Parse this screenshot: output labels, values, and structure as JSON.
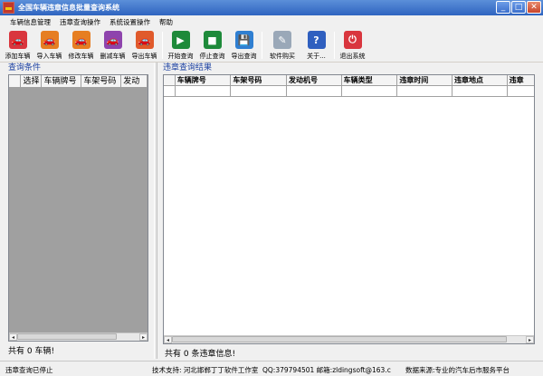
{
  "window": {
    "title": "全国车辆违章信息批量查询系统",
    "controls": {
      "minimize": "_",
      "maximize": "□",
      "close": "✕"
    }
  },
  "menu": {
    "items": [
      "车辆信息管理",
      "违章查询操作",
      "系统设置操作",
      "帮助"
    ]
  },
  "toolbar": {
    "buttons": [
      {
        "label": "添加车辆",
        "icon": "add-car-icon",
        "color": "#d9363e"
      },
      {
        "label": "导入车辆",
        "icon": "import-car-icon",
        "color": "#e67e22"
      },
      {
        "label": "修改车辆",
        "icon": "edit-car-icon",
        "color": "#e67e22"
      },
      {
        "label": "删减车辆",
        "icon": "delete-car-icon",
        "color": "#8e44ad"
      },
      {
        "label": "导出车辆",
        "icon": "export-car-icon",
        "color": "#e05a2b"
      },
      {
        "label": "开始查询",
        "icon": "play-icon",
        "color": "#27a745"
      },
      {
        "label": "停止查询",
        "icon": "stop-icon",
        "color": "#27a745"
      },
      {
        "label": "导出查询",
        "icon": "save-icon",
        "color": "#2f7fd1"
      },
      {
        "label": "软件购买",
        "icon": "purchase-icon",
        "color": "#9aa8b8"
      },
      {
        "label": "关于...",
        "icon": "help-icon",
        "color": "#2f5fbf"
      },
      {
        "label": "退出系统",
        "icon": "power-icon",
        "color": "#d9363e"
      }
    ]
  },
  "left_panel": {
    "title": "查询条件",
    "columns": [
      "选择",
      "车辆牌号",
      "车架号码",
      "发动"
    ],
    "count_text": "共有 0 车辆!"
  },
  "right_panel": {
    "title": "违章查询结果",
    "columns": [
      "车辆牌号",
      "车架号码",
      "发动机号",
      "车辆类型",
      "违章时间",
      "违章地点",
      "违章"
    ],
    "count_text": "共有 0 条违章信息!"
  },
  "statusbar": {
    "status": "违章查询已停止",
    "support": "技术支持: 河北邯郸丁丁软件工作室",
    "contact": "QQ:379794501 邮箱:zldingsoft@163.c",
    "source": "数据来源:专业的汽车后市服务平台"
  },
  "colors": {
    "titlebar": "#2f64c0",
    "panel_title": "#1a3fa0",
    "grid_empty": "#a0a0a0"
  }
}
